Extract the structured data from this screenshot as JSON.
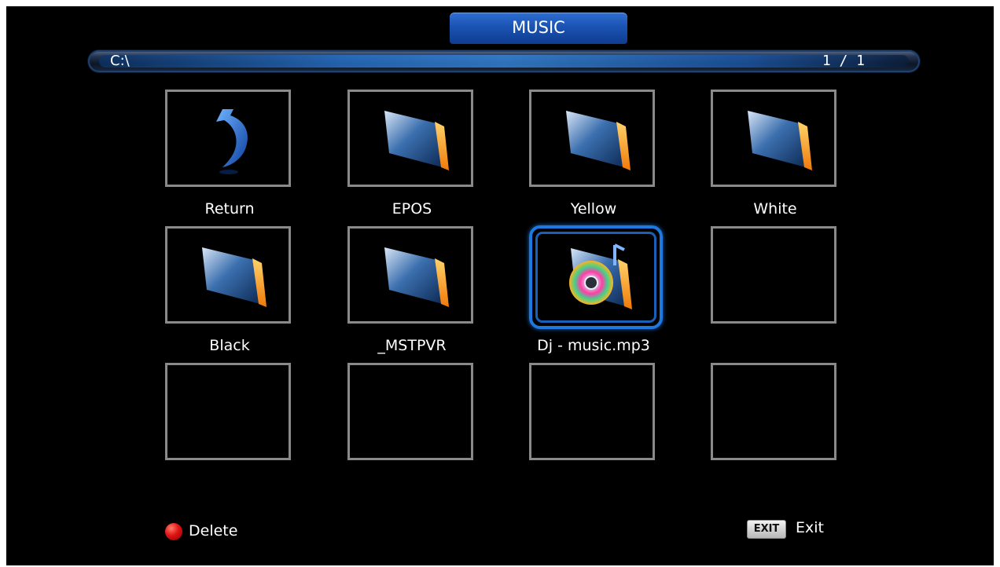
{
  "header": {
    "title": "MUSIC"
  },
  "path_bar": {
    "path": "C:\\",
    "page": "1 / 1"
  },
  "grid": {
    "items": [
      {
        "label": "Return",
        "icon": "return-arrow-icon"
      },
      {
        "label": "EPOS",
        "icon": "folder-icon"
      },
      {
        "label": "Yellow",
        "icon": "folder-icon"
      },
      {
        "label": "White",
        "icon": "folder-icon"
      },
      {
        "label": "Black",
        "icon": "folder-icon"
      },
      {
        "label": "_MSTPVR",
        "icon": "folder-icon"
      },
      {
        "label": "Dj - music.mp3",
        "icon": "music-file-icon",
        "selected": true
      },
      {
        "label": "",
        "icon": ""
      },
      {
        "label": "",
        "icon": ""
      },
      {
        "label": "",
        "icon": ""
      },
      {
        "label": "",
        "icon": ""
      },
      {
        "label": "",
        "icon": ""
      }
    ]
  },
  "footer": {
    "delete_label": "Delete",
    "exit_key": "EXIT",
    "exit_label": "Exit"
  },
  "colors": {
    "accent": "#1f78e0",
    "tile_border": "#8a8a8a",
    "background": "#000000"
  }
}
